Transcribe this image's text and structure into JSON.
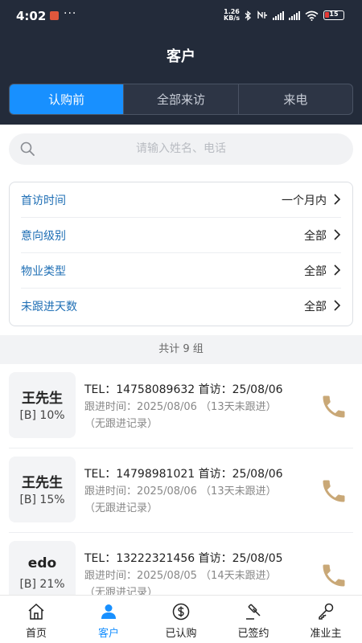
{
  "status_bar": {
    "time": "4:02",
    "speed_top": "1.26",
    "speed_bottom": "KB/s",
    "battery": "15",
    "icons": [
      "app-icon",
      "more-dots-icon",
      "bluetooth-icon",
      "nfc-icon",
      "signal-icon",
      "wifi-icon",
      "battery-icon"
    ]
  },
  "header": {
    "title": "客户"
  },
  "segments": [
    {
      "label": "认购前",
      "active": true
    },
    {
      "label": "全部来访",
      "active": false
    },
    {
      "label": "来电",
      "active": false
    }
  ],
  "search": {
    "placeholder": "请输入姓名、电话"
  },
  "filters": [
    {
      "label": "首访时间",
      "value": "一个月内"
    },
    {
      "label": "意向级别",
      "value": "全部"
    },
    {
      "label": "物业类型",
      "value": "全部"
    },
    {
      "label": "未跟进天数",
      "value": "全部"
    }
  ],
  "summary": {
    "total_text": "共计 9 组"
  },
  "customers": [
    {
      "name": "王先生",
      "level": "[B] 10%",
      "tel": "TEL：14758089632  首访：25/08/06",
      "follow": "跟进时间：2025/08/06 （13天未跟进）",
      "record": "（无跟进记录）"
    },
    {
      "name": "王先生",
      "level": "[B] 15%",
      "tel": "TEL：14798981021  首访：25/08/06",
      "follow": "跟进时间：2025/08/06 （13天未跟进）",
      "record": "（无跟进记录）"
    },
    {
      "name": "edo",
      "level": "[B] 21%",
      "tel": "TEL：13222321456  首访：25/08/05",
      "follow": "跟进时间：2025/08/05 （14天未跟进）",
      "record": "（无跟进记录）"
    }
  ],
  "colors": {
    "header_bg": "#232b3a",
    "accent": "#1890ff",
    "filter_label": "#1f6fb5",
    "phone": "#c9a877"
  },
  "tabbar": [
    {
      "label": "首页",
      "icon": "home-icon",
      "active": false
    },
    {
      "label": "客户",
      "icon": "person-icon",
      "active": true
    },
    {
      "label": "已认购",
      "icon": "dollar-icon",
      "active": false
    },
    {
      "label": "已签约",
      "icon": "gavel-icon",
      "active": false
    },
    {
      "label": "准业主",
      "icon": "key-icon",
      "active": false
    }
  ]
}
